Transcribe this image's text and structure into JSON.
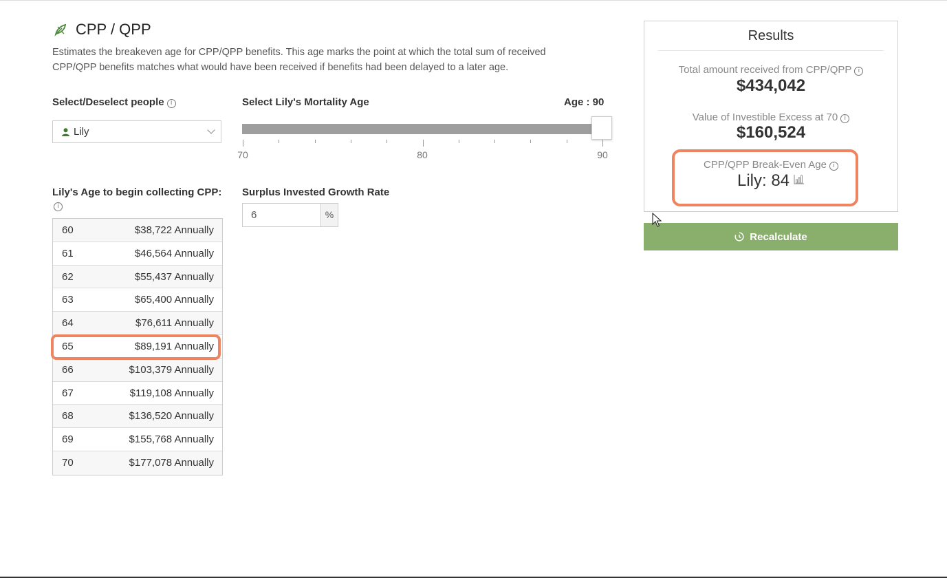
{
  "header": {
    "title": "CPP / QPP",
    "description": "Estimates the breakeven age for CPP/QPP benefits. This age marks the point at which the total sum of received CPP/QPP benefits matches what would have been received if benefits had been delayed to a later age."
  },
  "people": {
    "label": "Select/Deselect people",
    "selected": "Lily"
  },
  "mortality": {
    "label": "Select Lily's Mortality Age",
    "value_label": "Age : 90",
    "value": 90,
    "min": 70,
    "max": 90,
    "tick_labels": [
      "70",
      "80",
      "90"
    ]
  },
  "collect": {
    "label": "Lily's Age to begin collecting CPP:",
    "selected_age": "65",
    "rows": [
      {
        "age": "60",
        "amount": "$38,722 Annually"
      },
      {
        "age": "61",
        "amount": "$46,564 Annually"
      },
      {
        "age": "62",
        "amount": "$55,437 Annually"
      },
      {
        "age": "63",
        "amount": "$65,400 Annually"
      },
      {
        "age": "64",
        "amount": "$76,611 Annually"
      },
      {
        "age": "65",
        "amount": "$89,191 Annually"
      },
      {
        "age": "66",
        "amount": "$103,379 Annually"
      },
      {
        "age": "67",
        "amount": "$119,108 Annually"
      },
      {
        "age": "68",
        "amount": "$136,520 Annually"
      },
      {
        "age": "69",
        "amount": "$155,768 Annually"
      },
      {
        "age": "70",
        "amount": "$177,078 Annually"
      }
    ]
  },
  "growth": {
    "label": "Surplus Invested Growth Rate",
    "value": "6",
    "unit": "%"
  },
  "results": {
    "title": "Results",
    "total_label": "Total amount received from CPP/QPP",
    "total_value": "$434,042",
    "excess_label": "Value of Investible Excess at 70",
    "excess_value": "$160,524",
    "breakeven_label": "CPP/QPP Break-Even Age",
    "breakeven_value": "Lily: 84"
  },
  "actions": {
    "recalculate_label": "Recalculate"
  },
  "colors": {
    "accent_green": "#8aaf6c",
    "highlight": "#ee8460",
    "slider_fill": "#9e9e9e"
  }
}
